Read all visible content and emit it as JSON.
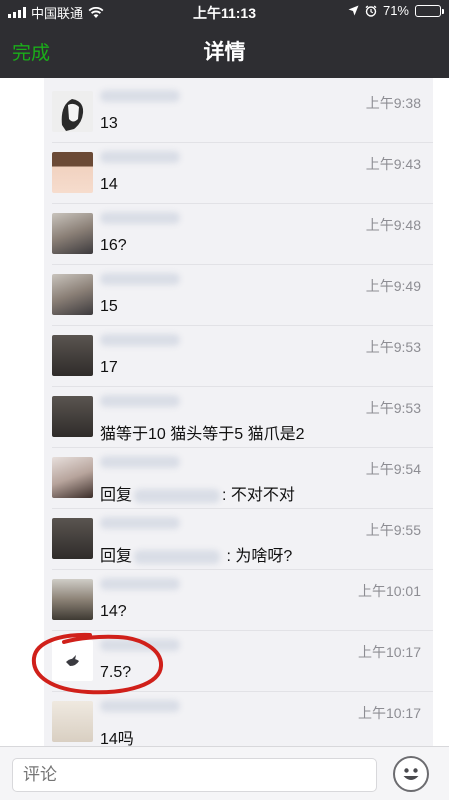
{
  "status_bar": {
    "carrier": "中国联通",
    "time": "上午11:13",
    "battery": "71%"
  },
  "nav": {
    "done_label": "完成",
    "title": "详情"
  },
  "comments": [
    {
      "time": "上午9:38",
      "text": "13"
    },
    {
      "time": "上午9:43",
      "text": "14"
    },
    {
      "time": "上午9:48",
      "text": "16?"
    },
    {
      "time": "上午9:49",
      "text": "15"
    },
    {
      "time": "上午9:53",
      "text": "17"
    },
    {
      "time": "上午9:53",
      "text": "猫等于10 猫头等于5 猫爪是2"
    },
    {
      "time": "上午9:54",
      "reply_prefix": "回复",
      "reply_suffix": ": 不对不对"
    },
    {
      "time": "上午9:55",
      "reply_prefix": "回复",
      "reply_suffix": " : 为啥呀?"
    },
    {
      "time": "上午10:01",
      "text": "14?"
    },
    {
      "time": "上午10:17",
      "text": "7.5?"
    },
    {
      "time": "上午10:17",
      "text": "14吗"
    }
  ],
  "comment_bar": {
    "placeholder": "评论"
  },
  "colors": {
    "nav_bg": "#2e2e32",
    "accent_green": "#1aad19",
    "highlight_red": "#d0201a"
  },
  "icons": [
    "signal-bars-icon",
    "wifi-icon",
    "location-arrow-icon",
    "alarm-clock-icon",
    "battery-icon",
    "emoji-icon"
  ]
}
